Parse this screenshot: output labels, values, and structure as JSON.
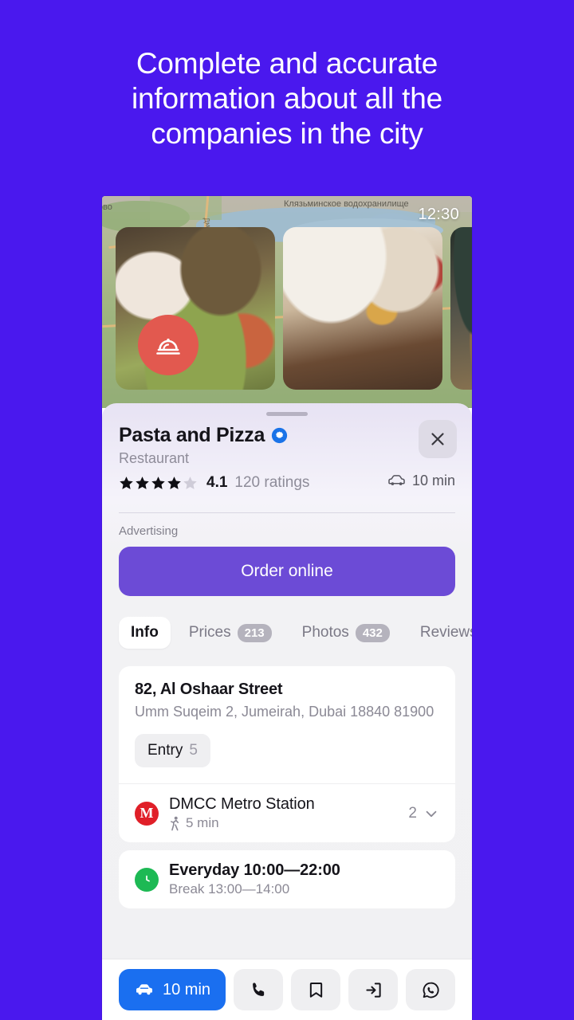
{
  "promo": {
    "headline": "Complete and accurate information about all the companies in the city",
    "background_color": "#4a18ee"
  },
  "map": {
    "label_left": "ково",
    "label_center": "Клязьминское водохранилище",
    "label_road": "Дмитровское ш.",
    "status_time": "12:30"
  },
  "photos": {
    "badge_icon": "food-cloche-icon",
    "badge_color": "#e2594f",
    "items": [
      {
        "alt_name": "dish-photo"
      },
      {
        "alt_name": "interior-photo"
      },
      {
        "alt_name": "terrace-photo"
      }
    ]
  },
  "business": {
    "name": "Pasta and Pizza",
    "verified_icon": "verified-badge-icon",
    "verified_color": "#1a73e8",
    "category": "Restaurant",
    "rating_value": "4.1",
    "rating_count": "120 ratings",
    "stars_filled": 4,
    "stars_total": 5,
    "drive_time": "10 min",
    "drive_icon": "car-icon",
    "close_icon": "close-icon"
  },
  "advertising": {
    "label": "Advertising",
    "cta_label": "Order online",
    "cta_color": "#6c4bd6"
  },
  "tabs": [
    {
      "label": "Info",
      "badge": "",
      "active": true
    },
    {
      "label": "Prices",
      "badge": "213",
      "active": false
    },
    {
      "label": "Photos",
      "badge": "432",
      "active": false
    },
    {
      "label": "Reviews",
      "badge": "",
      "active": false
    }
  ],
  "address": {
    "street": "82, Al Oshaar Street",
    "region": "Umm Suqeim 2, Jumeirah, Dubai 18840 81900",
    "entry_label": "Entry",
    "entry_number": "5"
  },
  "metro": {
    "icon": "metro-m-icon",
    "icon_color": "#e01f28",
    "station": "DMCC Metro Station",
    "walk_icon": "walking-icon",
    "walk_time": "5 min",
    "count": "2",
    "chevron_icon": "chevron-down-icon"
  },
  "hours": {
    "icon": "clock-icon",
    "icon_color": "#1db954",
    "schedule": "Everyday 10:00—22:00",
    "break": "Break 13:00—14:00"
  },
  "bottom_bar": {
    "route_label": "10 min",
    "route_icon": "car-icon",
    "route_color": "#1a6ff0",
    "actions": [
      {
        "icon": "phone-icon"
      },
      {
        "icon": "bookmark-icon"
      },
      {
        "icon": "enter-door-icon"
      },
      {
        "icon": "whatsapp-icon"
      }
    ]
  }
}
